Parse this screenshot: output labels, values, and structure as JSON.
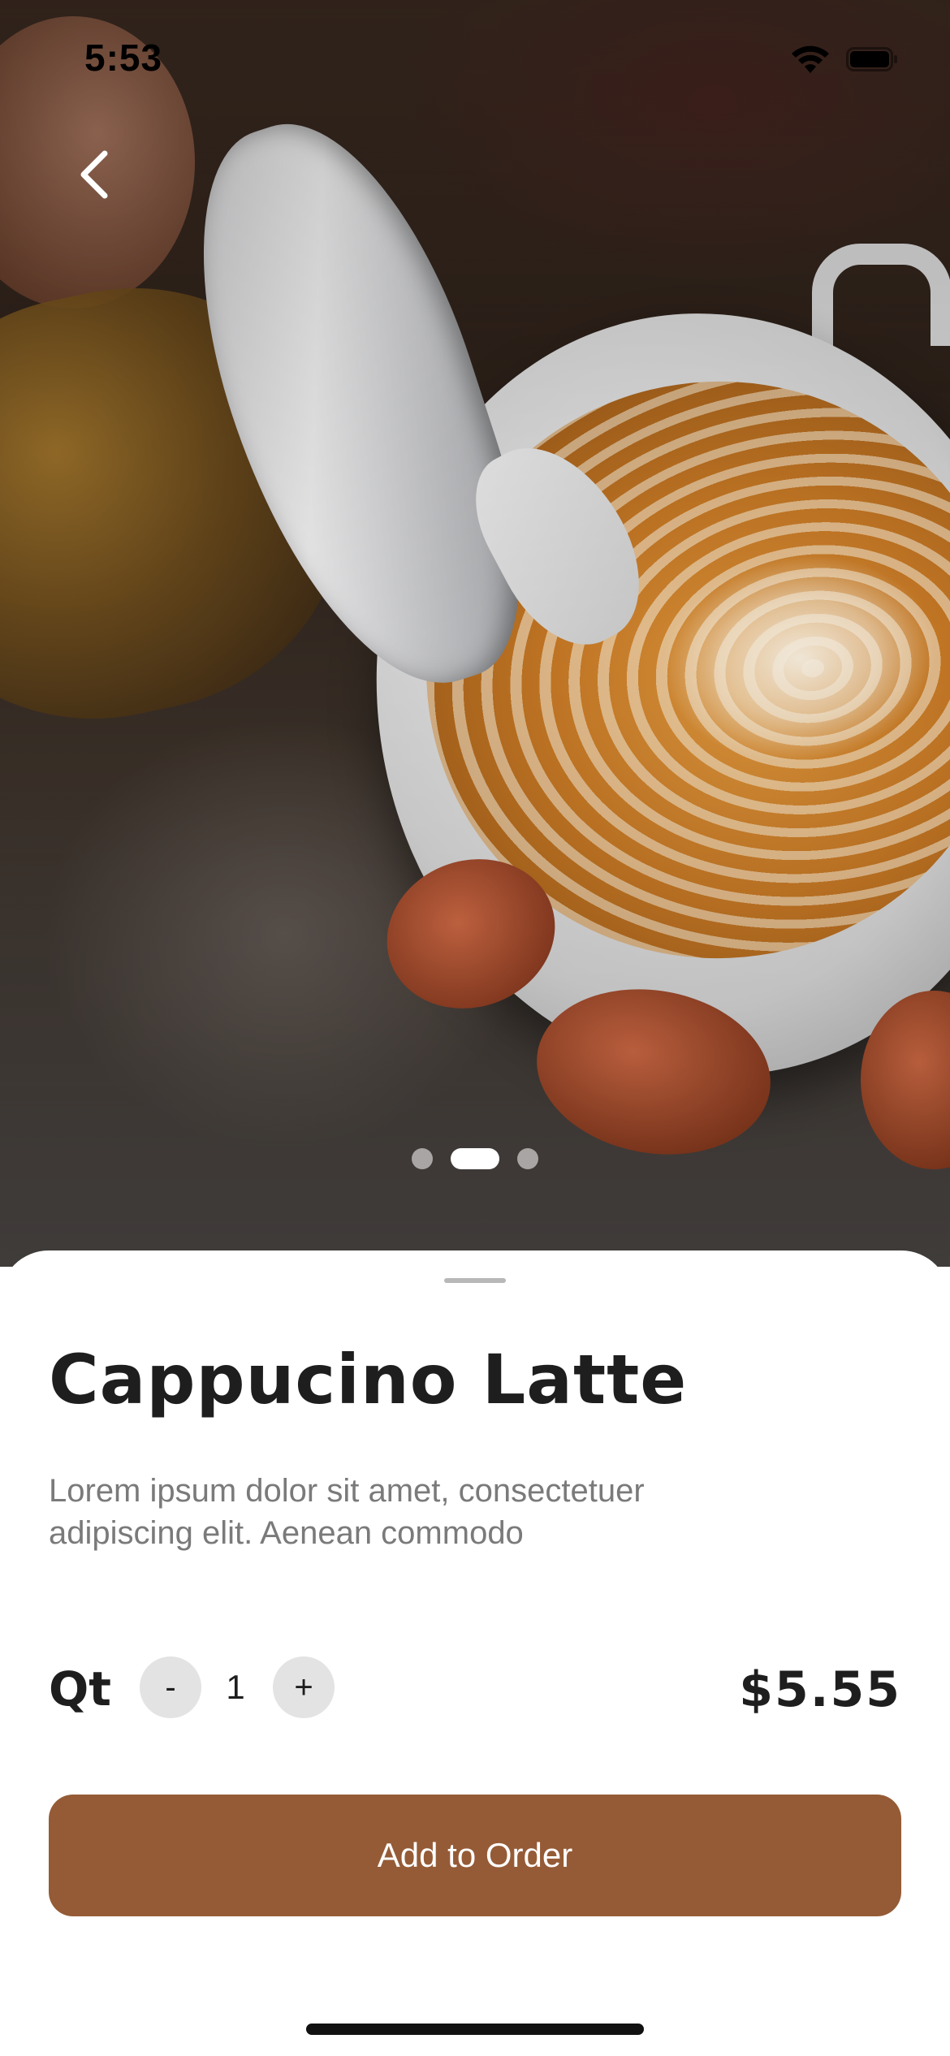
{
  "status_bar": {
    "time": "5:53",
    "wifi_icon": "wifi-icon",
    "battery_icon": "battery-icon"
  },
  "hero": {
    "image": "latte-art-pour-photo",
    "back_icon": "chevron-left-icon",
    "pager": {
      "count": 3,
      "active_index": 1
    }
  },
  "product": {
    "title": "Cappucino Latte",
    "description": "Lorem ipsum dolor sit amet, consectetuer adipiscing elit. Aenean commodo",
    "quantity_label": "Qt",
    "decrement_label": "-",
    "quantity": "1",
    "increment_label": "+",
    "price": "$5.55",
    "add_button_label": "Add to Order"
  },
  "colors": {
    "accent": "#955B36",
    "title": "#1E1E1E",
    "description": "#7A7A7A",
    "stepper_bg": "#E3E3E3"
  }
}
